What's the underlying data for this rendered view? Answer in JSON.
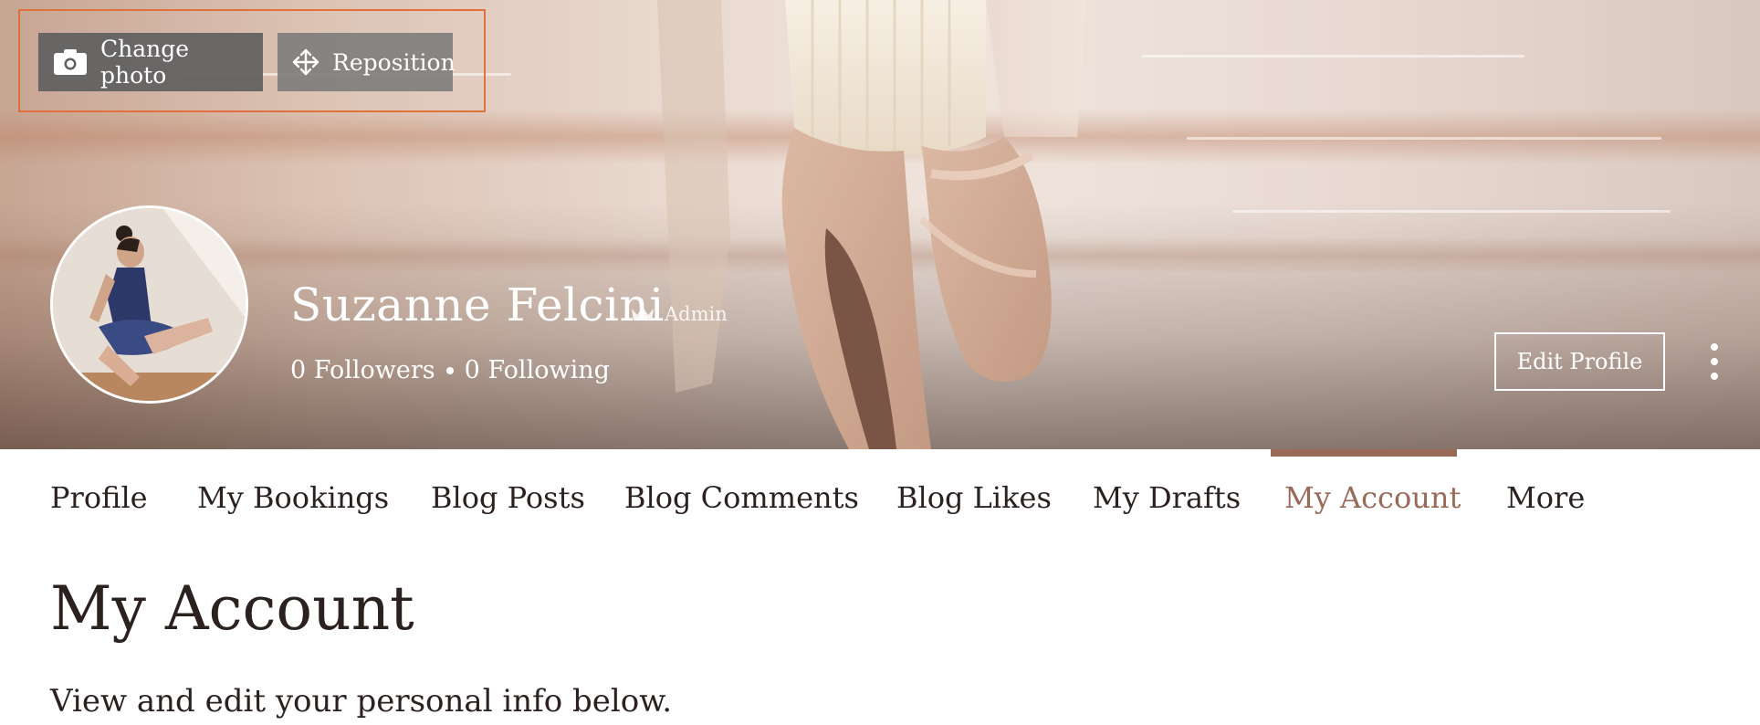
{
  "cover": {
    "change_photo_label": "Change photo",
    "reposition_label": "Reposition"
  },
  "profile": {
    "name": "Suzanne Felcini",
    "role_badge": "Admin",
    "followers": "0 Followers",
    "following": "0 Following",
    "edit_profile_label": "Edit Profile"
  },
  "tabs": [
    {
      "label": "Profile"
    },
    {
      "label": "My Bookings"
    },
    {
      "label": "Blog Posts"
    },
    {
      "label": "Blog Comments"
    },
    {
      "label": "Blog Likes"
    },
    {
      "label": "My Drafts"
    },
    {
      "label": "My Account",
      "active": true
    },
    {
      "label": "More"
    }
  ],
  "content": {
    "title": "My Account",
    "subtitle": "View and edit your personal info below."
  },
  "icons": {
    "camera": "camera-icon",
    "move": "move-arrows-icon",
    "crown": "crown-icon",
    "more": "vertical-dots-icon"
  },
  "colors": {
    "accent": "#9a6a58",
    "highlight_border": "#e2703a",
    "text": "#2b2220"
  }
}
